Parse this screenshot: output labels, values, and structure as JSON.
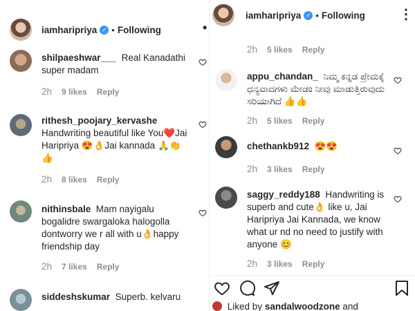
{
  "left_post": {
    "header": {
      "username": "iamharipriya",
      "following": "Following",
      "more": "•"
    },
    "comments": [
      {
        "user": "shilpaeshwar___",
        "text": "Real Kanadathi super madam",
        "time": "2h",
        "likes": "9 likes",
        "reply": "Reply"
      },
      {
        "user": "rithesh_poojary_kervashe",
        "text": "Handwriting beautiful like You❤️Jai Haripriya 😍👌Jai kannada 🙏👏 👍",
        "time": "2h",
        "likes": "8 likes",
        "reply": "Reply"
      },
      {
        "user": "nithinsbale",
        "text": "Mam nayigalu bogalidre swargaloka halogolla dontworry we r all with u👌happy friendship day",
        "time": "2h",
        "likes": "7 likes",
        "reply": "Reply"
      },
      {
        "user": "siddeshskumar",
        "text": "Superb. kelvaru",
        "time": "",
        "likes": "",
        "reply": ""
      }
    ]
  },
  "right_post": {
    "header": {
      "username": "iamharipriya",
      "following": "Following",
      "more": "⋮"
    },
    "top_meta": {
      "time": "2h",
      "likes": "5 likes",
      "reply": "Reply"
    },
    "comments": [
      {
        "user": "appu_chandan_",
        "text": "ನಿಮ್ಮ ಕನ್ನಡ ಪ್ರೇಮಕ್ಕೆ ಧನ್ಯವಾದಗಳು ಮೇಡಂ ನೀವು ಮಾಡುತ್ತಿರುವುದು ಸರಿಯಾಗಿದೆ 👍👍",
        "time": "2h",
        "likes": "5 likes",
        "reply": "Reply"
      },
      {
        "user": "chethankb912",
        "text": "😍😍",
        "time": "2h",
        "likes": "3 likes",
        "reply": "Reply"
      },
      {
        "user": "saggy_reddy188",
        "text": "Handwriting is superb and cute👌 like u, Jai Haripriya Jai Kannada, we know what ur nd no need to justify with anyone 😊",
        "time": "2h",
        "likes": "3 likes",
        "reply": "Reply"
      }
    ],
    "liked_by_prefix": "Liked by",
    "liked_by_user": "sandalwoodzone",
    "liked_by_suffix": "and"
  },
  "colors": {
    "text": "#262626",
    "muted": "#8e8e8e",
    "verified": "#3897f0",
    "border": "#efefef"
  },
  "icons": [
    "verified-badge-icon",
    "heart-icon",
    "comment-icon",
    "share-icon",
    "bookmark-icon",
    "more-options-icon"
  ]
}
